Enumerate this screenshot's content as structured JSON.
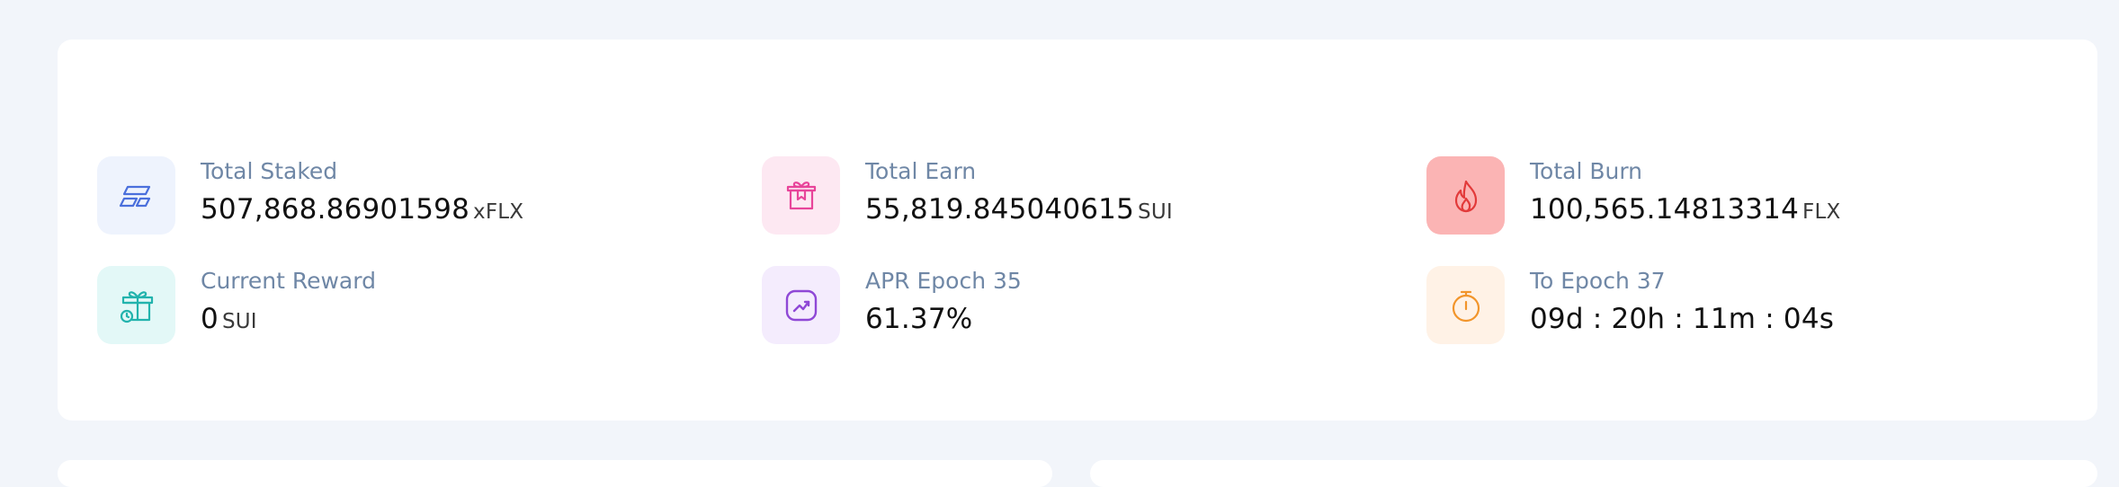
{
  "stats": [
    {
      "key": "total_staked",
      "label": "Total Staked",
      "value": "507,868.86901598",
      "unit": "xFLX",
      "icon": "staked-icon",
      "bg": "#eef3fd",
      "color": "#4a6fdc"
    },
    {
      "key": "total_earn",
      "label": "Total Earn",
      "value": "55,819.845040615",
      "unit": "SUI",
      "icon": "gift-box-icon",
      "bg": "#fde8f2",
      "color": "#e8449a"
    },
    {
      "key": "total_burn",
      "label": "Total Burn",
      "value": "100,565.14813314",
      "unit": "FLX",
      "icon": "flame-icon",
      "bg": "#fbb4b4",
      "color": "#e23a3a"
    },
    {
      "key": "current_reward",
      "label": "Current Reward",
      "value": "0",
      "unit": "SUI",
      "icon": "gift-icon",
      "bg": "#e3f8f7",
      "color": "#22b3ad"
    },
    {
      "key": "apr",
      "label": "APR Epoch 35",
      "value": "61.37%",
      "unit": "",
      "icon": "trend-up-icon",
      "bg": "#f4ecfd",
      "color": "#8f48d6"
    },
    {
      "key": "to_epoch",
      "label": "To Epoch 37",
      "value": "09d : 20h : 11m : 04s",
      "unit": "",
      "icon": "stopwatch-icon",
      "bg": "#fff2e6",
      "color": "#f2952b"
    }
  ]
}
